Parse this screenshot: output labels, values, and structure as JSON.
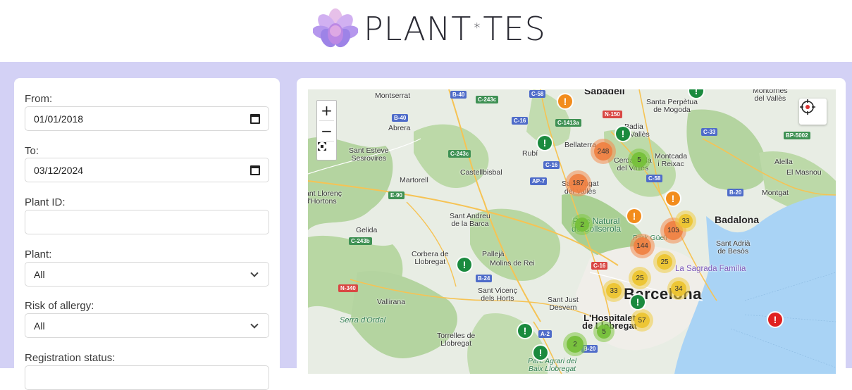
{
  "brand": {
    "name_left": "PLANT",
    "name_sep": "*",
    "name_right": "TES"
  },
  "filters": {
    "from": {
      "label": "From:",
      "value": "01/01/2018"
    },
    "to": {
      "label": "To:",
      "value": "03/12/2024"
    },
    "plant_id": {
      "label": "Plant ID:",
      "value": ""
    },
    "plant": {
      "label": "Plant:",
      "value": "All"
    },
    "risk": {
      "label": "Risk of allergy:",
      "value": "All"
    },
    "status": {
      "label": "Registration status:"
    }
  },
  "map": {
    "zoom_in": "+",
    "zoom_out": "−",
    "places": {
      "montserrat": "Montserrat",
      "sabadell": "Sabadell",
      "santa_perpetua": "Santa Perpètua\nde Mogoda",
      "montornes": "Montornès\ndel Vallès",
      "abrera": "Abrera",
      "sant_esteve": "Sant Esteve\nSesrovires",
      "rubi": "Rubí",
      "badia": "Badia\ndel Vallès",
      "bellaterra": "Bellaterra",
      "martorell": "Martorell",
      "castellbisbal": "Castellbisbal",
      "cerdanyola": "Cerdanyola\ndel Vallès",
      "montcada": "Montcada\ni Reixac",
      "alella": "Alella",
      "el_masnou": "El Masnou",
      "montgat": "Montgat",
      "sant_llorenc": "ant Llorenç\nd'Hortons",
      "sant_cugat": "Sant Cugat\ndel Vallès",
      "sant_andreu": "Sant Andreu\nde la Barca",
      "gelida": "Gelida",
      "parc_natural": "Parc Natural\nde Collserola",
      "badalona": "Badalona",
      "park_guell": "Park Güell",
      "sant_adria": "Sant Adrià\nde Besòs",
      "corbera": "Corbera de\nLlobregat",
      "palleja": "Pallejà",
      "molins": "Molins de Rei",
      "sagrada": "La Sagrada Família",
      "vallirana": "Vallirana",
      "sant_vicenc": "Sant Vicenç\ndels Horts",
      "sant_just": "Sant Just\nDesvern",
      "barcelona": "Barcelona",
      "serra_ordal": "Serra d'Ordal",
      "hospitalet": "L'Hospitalet\nde Llobregat",
      "torrelles": "Torrelles de\nLlobregat",
      "parc_agrari": "Parc Agrari del\nBaix Llobregat"
    },
    "roads": [
      "B-40",
      "C-243c",
      "C-58",
      "N-150",
      "C-1413a",
      "B-40",
      "C-16",
      "C-243c",
      "C-16",
      "C-33",
      "BP-5002",
      "AP-7",
      "C-58",
      "E-90",
      "B-20",
      "C-243b",
      "C-16",
      "B-24",
      "N-340",
      "A-2",
      "B-20"
    ],
    "clusters": [
      "248",
      "5",
      "187",
      "2",
      "103",
      "33",
      "144",
      "25",
      "25",
      "33",
      "34",
      "57",
      "5",
      "2"
    ],
    "pin_glyph": "!",
    "colors": {
      "orange_cluster": "#f08040",
      "yellow_cluster": "#ecc432",
      "green_cluster": "#76c03a",
      "green_pin": "#1a8a3e",
      "orange_pin": "#f28c1c",
      "red_pin": "#e0201f",
      "sea": "#a9d3f5",
      "forest": "#b4d4a0"
    }
  }
}
